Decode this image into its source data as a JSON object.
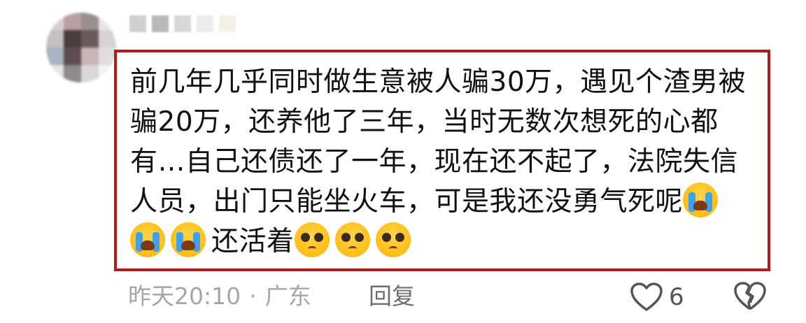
{
  "comment": {
    "text_before_crying": "前几年几乎同时做生意被人骗30万，遇见个渣男被骗20万，还养他了三年，当时无数次想死的心都有…自己还债还了一年，现在还不起了，法院失信人员，出门只能坐火车，可是我还没勇气死呢",
    "emoji_crying": "loudly-crying-face-icon",
    "text_between": "还活着",
    "emoji_pleading": "pleading-face-icon",
    "highlight_color": "#b41a1c"
  },
  "meta": {
    "time": "昨天20:10",
    "separator": "·",
    "location": "广东",
    "reply_label": "回复"
  },
  "actions": {
    "like_count": "6",
    "like_icon": "heart-outline-icon",
    "dislike_icon": "broken-heart-icon"
  }
}
